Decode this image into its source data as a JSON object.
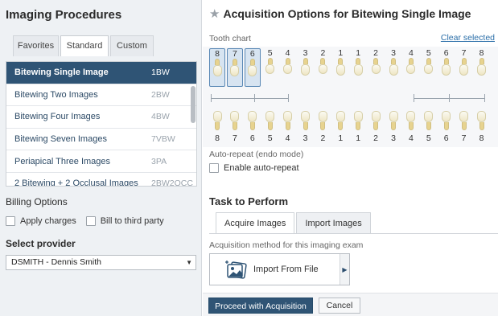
{
  "left": {
    "title": "Imaging Procedures",
    "tabs": [
      {
        "label": "Favorites",
        "active": false
      },
      {
        "label": "Standard",
        "active": true
      },
      {
        "label": "Custom",
        "active": false
      }
    ],
    "procedures": [
      {
        "name": "Bitewing Single Image",
        "code": "1BW",
        "selected": true
      },
      {
        "name": "Bitewing Two Images",
        "code": "2BW",
        "selected": false
      },
      {
        "name": "Bitewing Four Images",
        "code": "4BW",
        "selected": false
      },
      {
        "name": "Bitewing Seven Images",
        "code": "7VBW",
        "selected": false
      },
      {
        "name": "Periapical Three Images",
        "code": "3PA",
        "selected": false
      },
      {
        "name": "2 Bitewing + 2 Occlusal Images",
        "code": "2BW2OCC",
        "selected": false
      }
    ],
    "billing": {
      "title": "Billing Options",
      "apply_charges": "Apply charges",
      "bill_third_party": "Bill to third party"
    },
    "provider": {
      "title": "Select provider",
      "value": "DSMITH - Dennis Smith"
    }
  },
  "right": {
    "title": "Acquisition Options for Bitewing Single Image",
    "tooth_chart_label": "Tooth chart",
    "clear_selected": "Clear selected",
    "upper_teeth": [
      "8",
      "7",
      "6",
      "5",
      "4",
      "3",
      "2",
      "1",
      "1",
      "2",
      "3",
      "4",
      "5",
      "6",
      "7",
      "8"
    ],
    "lower_teeth": [
      "8",
      "7",
      "6",
      "5",
      "4",
      "3",
      "2",
      "1",
      "1",
      "2",
      "3",
      "4",
      "5",
      "6",
      "7",
      "8"
    ],
    "selected_upper_indexes": [
      0,
      1,
      2
    ],
    "auto_repeat_label": "Auto-repeat (endo mode)",
    "enable_auto_repeat": "Enable auto-repeat",
    "task_title": "Task to Perform",
    "task_tabs": [
      {
        "label": "Acquire Images",
        "active": true
      },
      {
        "label": "Import Images",
        "active": false
      }
    ],
    "acq_method_label": "Acquisition method for this imaging exam",
    "import_from_file": "Import From File",
    "proceed_button": "Proceed with Acquisition",
    "cancel_button": "Cancel"
  },
  "colors": {
    "accent": "#2f5475",
    "link": "#2a6ea8",
    "panel_bg": "#eef1f4"
  }
}
